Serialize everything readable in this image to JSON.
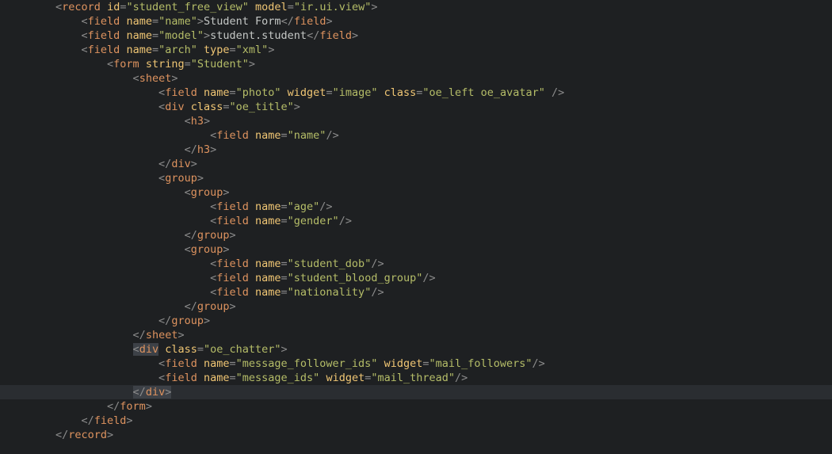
{
  "code_lines": [
    {
      "indent": 0,
      "hl": false,
      "tokens": [
        {
          "c": "p",
          "v": "<"
        },
        {
          "c": "t",
          "v": "record"
        },
        {
          "c": "tx",
          "v": " "
        },
        {
          "c": "a",
          "v": "id"
        },
        {
          "c": "p",
          "v": "="
        },
        {
          "c": "s",
          "v": "\"student_free_view\""
        },
        {
          "c": "tx",
          "v": " "
        },
        {
          "c": "a",
          "v": "model"
        },
        {
          "c": "p",
          "v": "="
        },
        {
          "c": "s",
          "v": "\"ir.ui.view\""
        },
        {
          "c": "p",
          "v": ">"
        }
      ]
    },
    {
      "indent": 1,
      "hl": false,
      "tokens": [
        {
          "c": "p",
          "v": "<"
        },
        {
          "c": "t",
          "v": "field"
        },
        {
          "c": "tx",
          "v": " "
        },
        {
          "c": "a",
          "v": "name"
        },
        {
          "c": "p",
          "v": "="
        },
        {
          "c": "s",
          "v": "\"name\""
        },
        {
          "c": "p",
          "v": ">"
        },
        {
          "c": "tx",
          "v": "Student Form"
        },
        {
          "c": "p",
          "v": "</"
        },
        {
          "c": "t",
          "v": "field"
        },
        {
          "c": "p",
          "v": ">"
        }
      ]
    },
    {
      "indent": 1,
      "hl": false,
      "tokens": [
        {
          "c": "p",
          "v": "<"
        },
        {
          "c": "t",
          "v": "field"
        },
        {
          "c": "tx",
          "v": " "
        },
        {
          "c": "a",
          "v": "name"
        },
        {
          "c": "p",
          "v": "="
        },
        {
          "c": "s",
          "v": "\"model\""
        },
        {
          "c": "p",
          "v": ">"
        },
        {
          "c": "tx",
          "v": "student.student"
        },
        {
          "c": "p",
          "v": "</"
        },
        {
          "c": "t",
          "v": "field"
        },
        {
          "c": "p",
          "v": ">"
        }
      ]
    },
    {
      "indent": 1,
      "hl": false,
      "tokens": [
        {
          "c": "p",
          "v": "<"
        },
        {
          "c": "t",
          "v": "field"
        },
        {
          "c": "tx",
          "v": " "
        },
        {
          "c": "a",
          "v": "name"
        },
        {
          "c": "p",
          "v": "="
        },
        {
          "c": "s",
          "v": "\"arch\""
        },
        {
          "c": "tx",
          "v": " "
        },
        {
          "c": "a",
          "v": "type"
        },
        {
          "c": "p",
          "v": "="
        },
        {
          "c": "s",
          "v": "\"xml\""
        },
        {
          "c": "p",
          "v": ">"
        }
      ]
    },
    {
      "indent": 2,
      "hl": false,
      "tokens": [
        {
          "c": "p",
          "v": "<"
        },
        {
          "c": "t",
          "v": "form"
        },
        {
          "c": "tx",
          "v": " "
        },
        {
          "c": "a",
          "v": "string"
        },
        {
          "c": "p",
          "v": "="
        },
        {
          "c": "s",
          "v": "\"Student\""
        },
        {
          "c": "p",
          "v": ">"
        }
      ]
    },
    {
      "indent": 3,
      "hl": false,
      "tokens": [
        {
          "c": "p",
          "v": "<"
        },
        {
          "c": "t",
          "v": "sheet"
        },
        {
          "c": "p",
          "v": ">"
        }
      ]
    },
    {
      "indent": 4,
      "hl": false,
      "tokens": [
        {
          "c": "p",
          "v": "<"
        },
        {
          "c": "t",
          "v": "field"
        },
        {
          "c": "tx",
          "v": " "
        },
        {
          "c": "a",
          "v": "name"
        },
        {
          "c": "p",
          "v": "="
        },
        {
          "c": "s",
          "v": "\"photo\""
        },
        {
          "c": "tx",
          "v": " "
        },
        {
          "c": "a",
          "v": "widget"
        },
        {
          "c": "p",
          "v": "="
        },
        {
          "c": "s",
          "v": "\"image\""
        },
        {
          "c": "tx",
          "v": " "
        },
        {
          "c": "a",
          "v": "class"
        },
        {
          "c": "p",
          "v": "="
        },
        {
          "c": "s",
          "v": "\"oe_left oe_avatar\""
        },
        {
          "c": "tx",
          "v": " "
        },
        {
          "c": "p",
          "v": "/>"
        }
      ]
    },
    {
      "indent": 4,
      "hl": false,
      "tokens": [
        {
          "c": "p",
          "v": "<"
        },
        {
          "c": "t",
          "v": "div"
        },
        {
          "c": "tx",
          "v": " "
        },
        {
          "c": "a",
          "v": "class"
        },
        {
          "c": "p",
          "v": "="
        },
        {
          "c": "s",
          "v": "\"oe_title\""
        },
        {
          "c": "p",
          "v": ">"
        }
      ]
    },
    {
      "indent": 5,
      "hl": false,
      "tokens": [
        {
          "c": "p",
          "v": "<"
        },
        {
          "c": "t",
          "v": "h3"
        },
        {
          "c": "p",
          "v": ">"
        }
      ]
    },
    {
      "indent": 6,
      "hl": false,
      "tokens": [
        {
          "c": "p",
          "v": "<"
        },
        {
          "c": "t",
          "v": "field"
        },
        {
          "c": "tx",
          "v": " "
        },
        {
          "c": "a",
          "v": "name"
        },
        {
          "c": "p",
          "v": "="
        },
        {
          "c": "s",
          "v": "\"name\""
        },
        {
          "c": "p",
          "v": "/>"
        }
      ]
    },
    {
      "indent": 5,
      "hl": false,
      "tokens": [
        {
          "c": "p",
          "v": "</"
        },
        {
          "c": "t",
          "v": "h3"
        },
        {
          "c": "p",
          "v": ">"
        }
      ]
    },
    {
      "indent": 4,
      "hl": false,
      "tokens": [
        {
          "c": "p",
          "v": "</"
        },
        {
          "c": "t",
          "v": "div"
        },
        {
          "c": "p",
          "v": ">"
        }
      ]
    },
    {
      "indent": 4,
      "hl": false,
      "tokens": [
        {
          "c": "p",
          "v": "<"
        },
        {
          "c": "t",
          "v": "group"
        },
        {
          "c": "p",
          "v": ">"
        }
      ]
    },
    {
      "indent": 5,
      "hl": false,
      "tokens": [
        {
          "c": "p",
          "v": "<"
        },
        {
          "c": "t",
          "v": "group"
        },
        {
          "c": "p",
          "v": ">"
        }
      ]
    },
    {
      "indent": 6,
      "hl": false,
      "tokens": [
        {
          "c": "p",
          "v": "<"
        },
        {
          "c": "t",
          "v": "field"
        },
        {
          "c": "tx",
          "v": " "
        },
        {
          "c": "a",
          "v": "name"
        },
        {
          "c": "p",
          "v": "="
        },
        {
          "c": "s",
          "v": "\"age\""
        },
        {
          "c": "p",
          "v": "/>"
        }
      ]
    },
    {
      "indent": 6,
      "hl": false,
      "tokens": [
        {
          "c": "p",
          "v": "<"
        },
        {
          "c": "t",
          "v": "field"
        },
        {
          "c": "tx",
          "v": " "
        },
        {
          "c": "a",
          "v": "name"
        },
        {
          "c": "p",
          "v": "="
        },
        {
          "c": "s",
          "v": "\"gender\""
        },
        {
          "c": "p",
          "v": "/>"
        }
      ]
    },
    {
      "indent": 5,
      "hl": false,
      "tokens": [
        {
          "c": "p",
          "v": "</"
        },
        {
          "c": "t",
          "v": "group"
        },
        {
          "c": "p",
          "v": ">"
        }
      ]
    },
    {
      "indent": 5,
      "hl": false,
      "tokens": [
        {
          "c": "p",
          "v": "<"
        },
        {
          "c": "t",
          "v": "group"
        },
        {
          "c": "p",
          "v": ">"
        }
      ]
    },
    {
      "indent": 6,
      "hl": false,
      "tokens": [
        {
          "c": "p",
          "v": "<"
        },
        {
          "c": "t",
          "v": "field"
        },
        {
          "c": "tx",
          "v": " "
        },
        {
          "c": "a",
          "v": "name"
        },
        {
          "c": "p",
          "v": "="
        },
        {
          "c": "s",
          "v": "\"student_dob\""
        },
        {
          "c": "p",
          "v": "/>"
        }
      ]
    },
    {
      "indent": 6,
      "hl": false,
      "tokens": [
        {
          "c": "p",
          "v": "<"
        },
        {
          "c": "t",
          "v": "field"
        },
        {
          "c": "tx",
          "v": " "
        },
        {
          "c": "a",
          "v": "name"
        },
        {
          "c": "p",
          "v": "="
        },
        {
          "c": "s",
          "v": "\"student_blood_group\""
        },
        {
          "c": "p",
          "v": "/>"
        }
      ]
    },
    {
      "indent": 6,
      "hl": false,
      "tokens": [
        {
          "c": "p",
          "v": "<"
        },
        {
          "c": "t",
          "v": "field"
        },
        {
          "c": "tx",
          "v": " "
        },
        {
          "c": "a",
          "v": "name"
        },
        {
          "c": "p",
          "v": "="
        },
        {
          "c": "s",
          "v": "\"nationality\""
        },
        {
          "c": "p",
          "v": "/>"
        }
      ]
    },
    {
      "indent": 5,
      "hl": false,
      "tokens": [
        {
          "c": "p",
          "v": "</"
        },
        {
          "c": "t",
          "v": "group"
        },
        {
          "c": "p",
          "v": ">"
        }
      ]
    },
    {
      "indent": 4,
      "hl": false,
      "tokens": [
        {
          "c": "p",
          "v": "</"
        },
        {
          "c": "t",
          "v": "group"
        },
        {
          "c": "p",
          "v": ">"
        }
      ]
    },
    {
      "indent": 3,
      "hl": false,
      "tokens": [
        {
          "c": "p",
          "v": "</"
        },
        {
          "c": "t",
          "v": "sheet"
        },
        {
          "c": "p",
          "v": ">"
        }
      ]
    },
    {
      "indent": 3,
      "hl": false,
      "sel_first": true,
      "tokens": [
        {
          "c": "p",
          "v": "<"
        },
        {
          "c": "t",
          "v": "div"
        },
        {
          "c": "tx",
          "v": " "
        },
        {
          "c": "a",
          "v": "class"
        },
        {
          "c": "p",
          "v": "="
        },
        {
          "c": "s",
          "v": "\"oe_chatter\""
        },
        {
          "c": "p",
          "v": ">"
        }
      ]
    },
    {
      "indent": 4,
      "hl": false,
      "tokens": [
        {
          "c": "p",
          "v": "<"
        },
        {
          "c": "t",
          "v": "field"
        },
        {
          "c": "tx",
          "v": " "
        },
        {
          "c": "a",
          "v": "name"
        },
        {
          "c": "p",
          "v": "="
        },
        {
          "c": "s",
          "v": "\"message_follower_ids\""
        },
        {
          "c": "tx",
          "v": " "
        },
        {
          "c": "a",
          "v": "widget"
        },
        {
          "c": "p",
          "v": "="
        },
        {
          "c": "s",
          "v": "\"mail_followers\""
        },
        {
          "c": "p",
          "v": "/>"
        }
      ]
    },
    {
      "indent": 4,
      "hl": false,
      "tokens": [
        {
          "c": "p",
          "v": "<"
        },
        {
          "c": "t",
          "v": "field"
        },
        {
          "c": "tx",
          "v": " "
        },
        {
          "c": "a",
          "v": "name"
        },
        {
          "c": "p",
          "v": "="
        },
        {
          "c": "s",
          "v": "\"message_ids\""
        },
        {
          "c": "tx",
          "v": " "
        },
        {
          "c": "a",
          "v": "widget"
        },
        {
          "c": "p",
          "v": "="
        },
        {
          "c": "s",
          "v": "\"mail_thread\""
        },
        {
          "c": "p",
          "v": "/>"
        }
      ]
    },
    {
      "indent": 3,
      "hl": true,
      "sel_all": true,
      "tokens": [
        {
          "c": "p",
          "v": "</"
        },
        {
          "c": "t",
          "v": "div"
        },
        {
          "c": "p",
          "v": ">"
        }
      ]
    },
    {
      "indent": 2,
      "hl": false,
      "tokens": [
        {
          "c": "p",
          "v": "</"
        },
        {
          "c": "t",
          "v": "form"
        },
        {
          "c": "p",
          "v": ">"
        }
      ]
    },
    {
      "indent": 1,
      "hl": false,
      "tokens": [
        {
          "c": "p",
          "v": "</"
        },
        {
          "c": "t",
          "v": "field"
        },
        {
          "c": "p",
          "v": ">"
        }
      ]
    },
    {
      "indent": 0,
      "hl": false,
      "tokens": [
        {
          "c": "p",
          "v": "</"
        },
        {
          "c": "t",
          "v": "record"
        },
        {
          "c": "p",
          "v": ">"
        }
      ]
    }
  ],
  "indent_unit": "    "
}
